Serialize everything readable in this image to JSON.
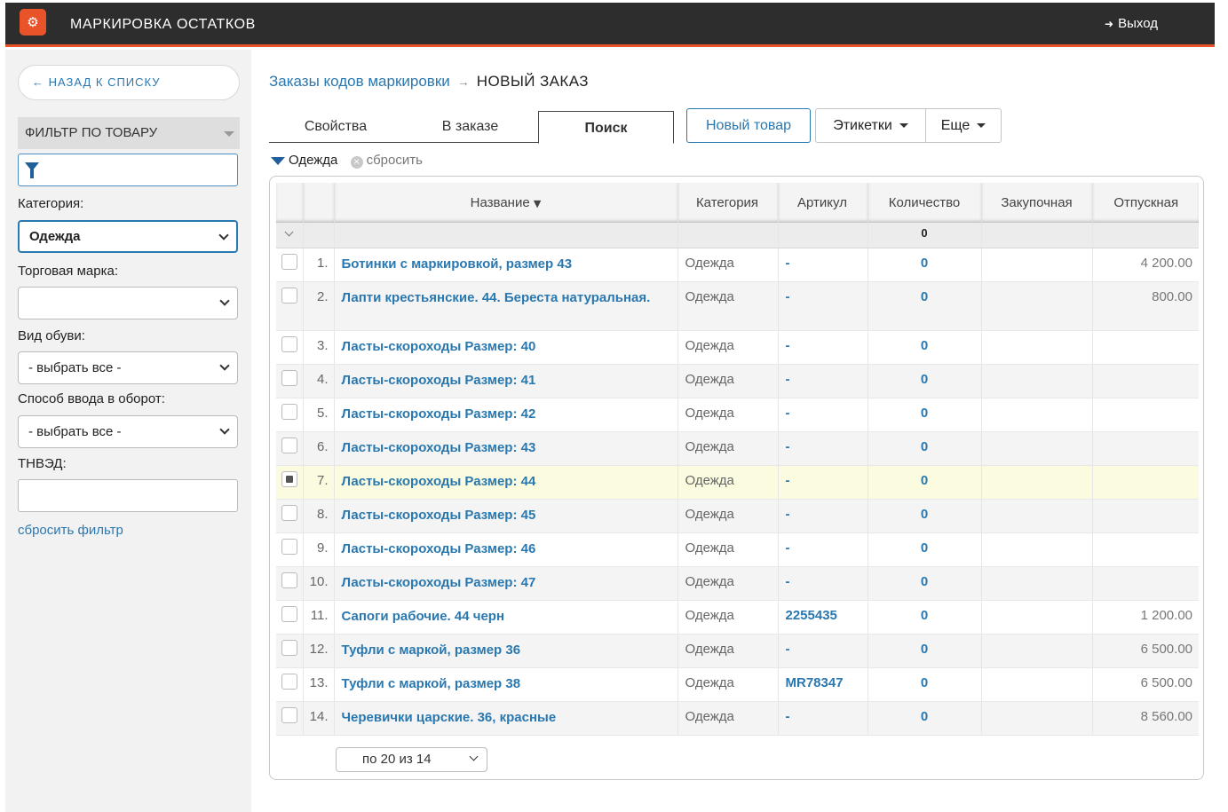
{
  "header": {
    "logo_glyph": "⚙",
    "title": "МАРКИРОВКА ОСТАТКОВ",
    "logout_icon": "➜",
    "logout_label": "Выход"
  },
  "sidebar": {
    "back_label": "← НАЗАД К СПИСКУ",
    "filter_title": "ФИЛЬТР ПО ТОВАРУ",
    "filter_value": "",
    "category_label": "Категория:",
    "category_value": "Одежда",
    "brand_label": "Торговая марка:",
    "brand_value": "",
    "shoe_type_label": "Вид обуви:",
    "shoe_type_value": "- выбрать все -",
    "circulation_label": "Способ ввода в оборот:",
    "circulation_value": "- выбрать все -",
    "tnved_label": "ТНВЭД:",
    "tnved_value": "",
    "reset_label": "сбросить фильтр"
  },
  "breadcrumb": {
    "link": "Заказы кодов маркировки",
    "arrow": "→",
    "current": "НОВЫЙ ЗАКАЗ"
  },
  "tabs": [
    "Свойства",
    "В заказе",
    "Поиск"
  ],
  "active_tab": "Поиск",
  "toolbar": {
    "new_item": "Новый товар",
    "labels": "Этикетки",
    "more": "Еще"
  },
  "active_filter": {
    "value": "Одежда",
    "reset_icon": "×",
    "reset_label": "сбросить"
  },
  "table": {
    "columns": [
      "Название",
      "Категория",
      "Артикул",
      "Количество",
      "Закупочная",
      "Отпускная"
    ],
    "sort_indicator": "▼",
    "total_quantity": "0",
    "rows": [
      {
        "n": "1.",
        "name": "Ботинки с маркировкой, размер 43",
        "category": "Одежда",
        "article": "-",
        "qty": "0",
        "buy": "",
        "sell": "4 200.00"
      },
      {
        "n": "2.",
        "name": "Лапти крестьянские. 44. Береста натуральная.",
        "category": "Одежда",
        "article": "-",
        "qty": "0",
        "buy": "",
        "sell": "800.00"
      },
      {
        "n": "3.",
        "name": "Ласты-скороходы Размер: 40",
        "category": "Одежда",
        "article": "-",
        "qty": "0",
        "buy": "",
        "sell": ""
      },
      {
        "n": "4.",
        "name": "Ласты-скороходы Размер: 41",
        "category": "Одежда",
        "article": "-",
        "qty": "0",
        "buy": "",
        "sell": ""
      },
      {
        "n": "5.",
        "name": "Ласты-скороходы Размер: 42",
        "category": "Одежда",
        "article": "-",
        "qty": "0",
        "buy": "",
        "sell": ""
      },
      {
        "n": "6.",
        "name": "Ласты-скороходы Размер: 43",
        "category": "Одежда",
        "article": "-",
        "qty": "0",
        "buy": "",
        "sell": ""
      },
      {
        "n": "7.",
        "name": "Ласты-скороходы Размер: 44",
        "category": "Одежда",
        "article": "-",
        "qty": "0",
        "buy": "",
        "sell": ""
      },
      {
        "n": "8.",
        "name": "Ласты-скороходы Размер: 45",
        "category": "Одежда",
        "article": "-",
        "qty": "0",
        "buy": "",
        "sell": ""
      },
      {
        "n": "9.",
        "name": "Ласты-скороходы Размер: 46",
        "category": "Одежда",
        "article": "-",
        "qty": "0",
        "buy": "",
        "sell": ""
      },
      {
        "n": "10.",
        "name": "Ласты-скороходы Размер: 47",
        "category": "Одежда",
        "article": "-",
        "qty": "0",
        "buy": "",
        "sell": ""
      },
      {
        "n": "11.",
        "name": "Сапоги рабочие. 44 черн",
        "category": "Одежда",
        "article": "2255435",
        "qty": "0",
        "buy": "",
        "sell": "1 200.00"
      },
      {
        "n": "12.",
        "name": "Туфли с маркой, размер 36",
        "category": "Одежда",
        "article": "-",
        "qty": "0",
        "buy": "",
        "sell": "6 500.00"
      },
      {
        "n": "13.",
        "name": "Туфли с маркой, размер 38",
        "category": "Одежда",
        "article": "MR78347",
        "qty": "0",
        "buy": "",
        "sell": "6 500.00"
      },
      {
        "n": "14.",
        "name": "Черевички царские. 36, красные",
        "category": "Одежда",
        "article": "-",
        "qty": "0",
        "buy": "",
        "sell": "8 560.00"
      }
    ]
  },
  "pager": {
    "label": "по 20 из 14"
  },
  "colors": {
    "accent": "#e8532a",
    "link": "#2a78b0",
    "topbar": "#2d2d2d",
    "selected_row": "#fbfbdf"
  }
}
